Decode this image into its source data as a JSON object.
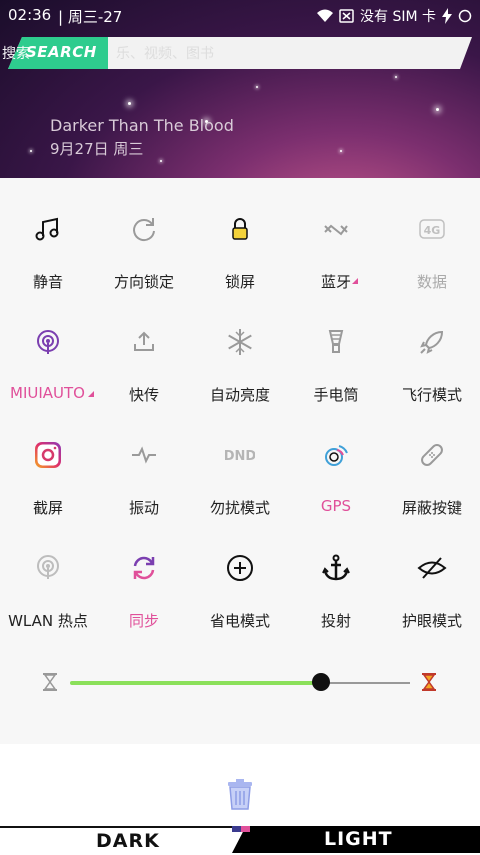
{
  "status": {
    "time": "02:36",
    "date": "| 周三-27",
    "signal_text": "没有 SIM 卡"
  },
  "search": {
    "label": "SEARCH",
    "hint_left": "搜索",
    "hint_right": "乐、视频、图书"
  },
  "now_playing": {
    "song": "Darker Than The Blood",
    "date": "9月27日 周三"
  },
  "tiles": [
    {
      "label": "静音",
      "icon": "music-note-icon"
    },
    {
      "label": "方向锁定",
      "icon": "rotate-icon"
    },
    {
      "label": "锁屏",
      "icon": "lock-icon"
    },
    {
      "label": "蓝牙",
      "icon": "bluetooth-icon"
    },
    {
      "label": "数据",
      "icon": "4g-icon"
    },
    {
      "label": "MIUIAUTO",
      "icon": "broadcast-icon"
    },
    {
      "label": "快传",
      "icon": "upload-icon"
    },
    {
      "label": "自动亮度",
      "icon": "snowflake-icon"
    },
    {
      "label": "手电筒",
      "icon": "bulb-icon"
    },
    {
      "label": "飞行模式",
      "icon": "rocket-icon"
    },
    {
      "label": "截屏",
      "icon": "camera-icon"
    },
    {
      "label": "振动",
      "icon": "pulse-icon"
    },
    {
      "label": "勿扰模式",
      "icon": "dnd-icon"
    },
    {
      "label": "GPS",
      "icon": "gps-icon"
    },
    {
      "label": "屏蔽按键",
      "icon": "bandage-icon"
    },
    {
      "label": "WLAN 热点",
      "icon": "hotspot-icon"
    },
    {
      "label": "同步",
      "icon": "sync-icon"
    },
    {
      "label": "省电模式",
      "icon": "plus-circle-icon"
    },
    {
      "label": "投射",
      "icon": "anchor-icon"
    },
    {
      "label": "护眼模式",
      "icon": "eye-off-icon"
    }
  ],
  "brightness": {
    "level": 0.74
  },
  "theme": {
    "dark_label": "DARK",
    "light_label": "LIGHT"
  },
  "colors": {
    "accent_pink": "#e0509a",
    "accent_green": "#8be05a",
    "search_green": "#2ecc8e"
  }
}
